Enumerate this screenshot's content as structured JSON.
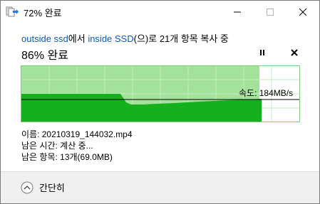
{
  "window": {
    "title": "72% 완료"
  },
  "subtitle": {
    "source": "outside ssd",
    "connector1": "에서 ",
    "destination": "inside SSD",
    "suffix": "(으)로 21개 항목 복사 중"
  },
  "progress": {
    "label": "86% 완료",
    "percent": 86
  },
  "speed": {
    "label": "속도: 184MB/s"
  },
  "details": {
    "name": "이름: 20210319_144032.mp4",
    "time_left": "남은 시간: 계산 중...",
    "items_left": "남은 항목: 13개(69.0MB)"
  },
  "footer": {
    "collapse_label": "간단히"
  },
  "colors": {
    "graph_fill_light": "#a3e29a",
    "graph_fill_dark": "#16b01f",
    "graph_border": "#6bc66b",
    "link": "#0a5bbf"
  },
  "icons": {
    "title": "copy-arrow-icon",
    "pause": "pause-icon",
    "stop": "close-icon",
    "collapse": "chevron-up-icon"
  }
}
